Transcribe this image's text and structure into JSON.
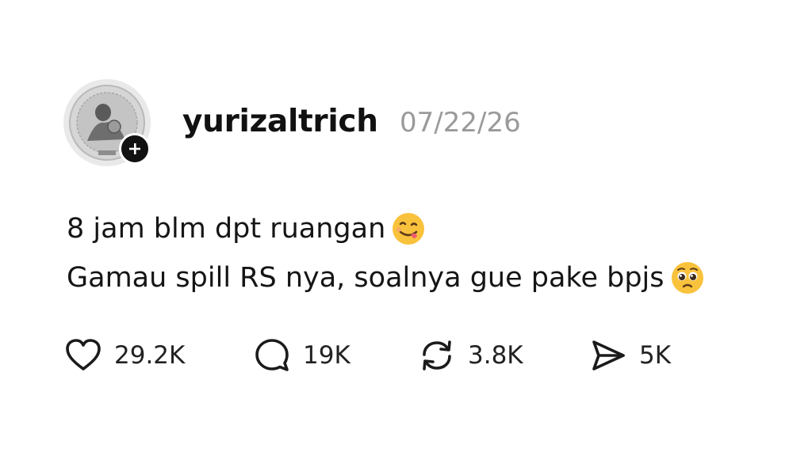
{
  "post": {
    "username": "yurizaltrich",
    "date": "07/22/26",
    "lines": [
      "8 jam blm dpt ruangan",
      "Gamau spill RS nya, soalnya gue pake bpjs"
    ],
    "line_emojis": [
      "face-savoring-food-emoji",
      "pleading-face-emoji"
    ]
  },
  "avatar": {
    "icon": "avatar-coin-image",
    "follow_icon": "plus-icon"
  },
  "actions": {
    "like": {
      "icon": "heart-icon",
      "count": "29.2K"
    },
    "comment": {
      "icon": "comment-bubble-icon",
      "count": "19K"
    },
    "repost": {
      "icon": "repost-icon",
      "count": "3.8K"
    },
    "share": {
      "icon": "send-icon",
      "count": "5K"
    }
  },
  "colors": {
    "text": "#151515",
    "date": "#9a9a9a",
    "badge": "#111111"
  }
}
